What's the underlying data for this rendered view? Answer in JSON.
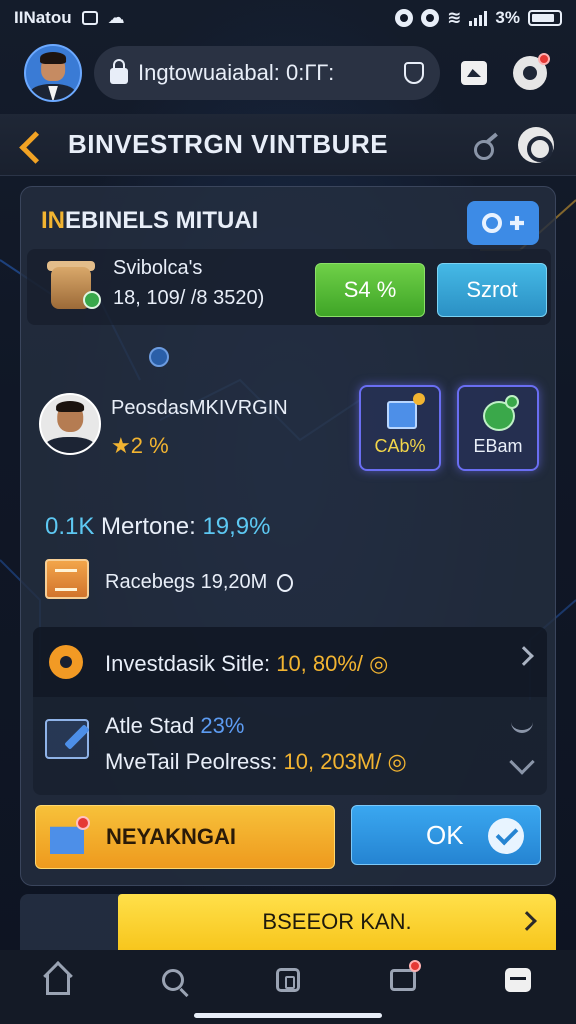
{
  "status_bar": {
    "carrier": "IINatou",
    "battery": "3%"
  },
  "top_bar": {
    "url": "Ingtowuaiabal: 0:ГГ:",
    "icons": [
      "avatar",
      "lock-icon",
      "shield-icon",
      "tab-icon",
      "gear-icon"
    ]
  },
  "header": {
    "title": "BINVESTRGN VINTBURE",
    "icons": [
      "brand-icon",
      "key-icon",
      "target-icon"
    ]
  },
  "card": {
    "title_highlight": "IN",
    "title_rest": "EBINELS MITUAI",
    "sub_label": "Svibolca's",
    "sub_value": "18, 109/ /8 3520)",
    "green_button": "S4 %",
    "cyan_button": "Szrot",
    "person_name": "PeosdasMKIVRGIN",
    "person_rating": "★2 %",
    "tile_1_label": "CAb%",
    "tile_2_label": "EBam",
    "stat_value_a": "0.1K",
    "stat_label": "Mertone:",
    "stat_value_b": "19,9%",
    "doc_text": "Racebegs 19,20M",
    "row_1_label": "Investdasik Sitle:",
    "row_1_value": "10, 80%/ ◎",
    "row_2_label": "Atle Stad",
    "row_2_value": "23%",
    "row_3_label": "MveTail Peolress:",
    "row_3_value": "10, 203M/ ◎",
    "primary_button": "NEYAKNGAI",
    "ok_button": "OK"
  },
  "banner": {
    "label": "BSEEOR KAN."
  },
  "bottom_nav": {
    "items": [
      "home-icon",
      "search-icon",
      "square-icon",
      "bag-icon",
      "menu-icon"
    ]
  },
  "colors": {
    "accent_yellow": "#f2b431",
    "accent_blue": "#3d8be6",
    "accent_green": "#4fbf35",
    "accent_cyan": "#3aa7f0",
    "background": "#0f1521"
  }
}
